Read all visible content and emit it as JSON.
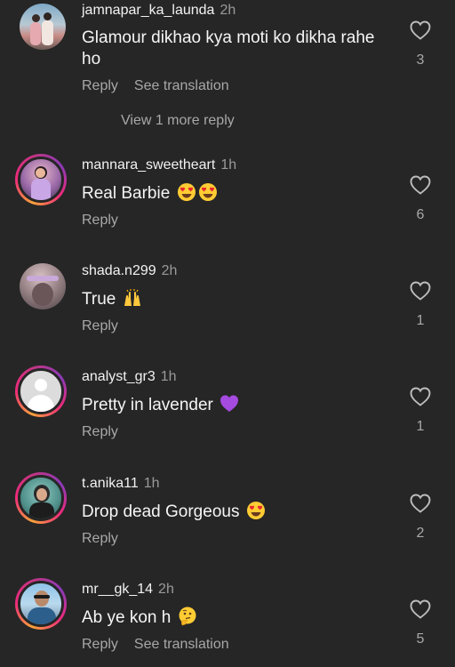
{
  "comments": [
    {
      "username": "jamnapar_ka_launda",
      "time": "2h",
      "text": "Glamour dikhao kya moti ko dikha rahe ho",
      "reply_label": "Reply",
      "translate_label": "See translation",
      "likes": "3",
      "view_more": "View 1 more reply"
    },
    {
      "username": "mannara_sweetheart",
      "time": "1h",
      "text": "Real Barbie",
      "emojis": [
        "heart-eyes-emoji",
        "heart-eyes-emoji"
      ],
      "reply_label": "Reply",
      "likes": "6"
    },
    {
      "username": "shada.n299",
      "time": "2h",
      "text": "True",
      "emojis": [
        "raising-hands-emoji"
      ],
      "reply_label": "Reply",
      "likes": "1"
    },
    {
      "username": "analyst_gr3",
      "time": "1h",
      "text": "Pretty in lavender",
      "emojis": [
        "purple-heart-emoji"
      ],
      "reply_label": "Reply",
      "likes": "1"
    },
    {
      "username": "t.anika11",
      "time": "1h",
      "text": "Drop dead Gorgeous",
      "emojis": [
        "heart-eyes-emoji"
      ],
      "reply_label": "Reply",
      "likes": "2"
    },
    {
      "username": "mr__gk_14",
      "time": "2h",
      "text": "Ab ye kon h",
      "emojis": [
        "thinking-face-emoji"
      ],
      "reply_label": "Reply",
      "translate_label": "See translation",
      "likes": "5"
    }
  ],
  "colors": {
    "background": "#262626",
    "primary_text": "#f5f5f5",
    "secondary_text": "#a8a8a8",
    "story_ring": [
      "#f9a23a",
      "#ee2a7b",
      "#8a3ab9"
    ]
  }
}
